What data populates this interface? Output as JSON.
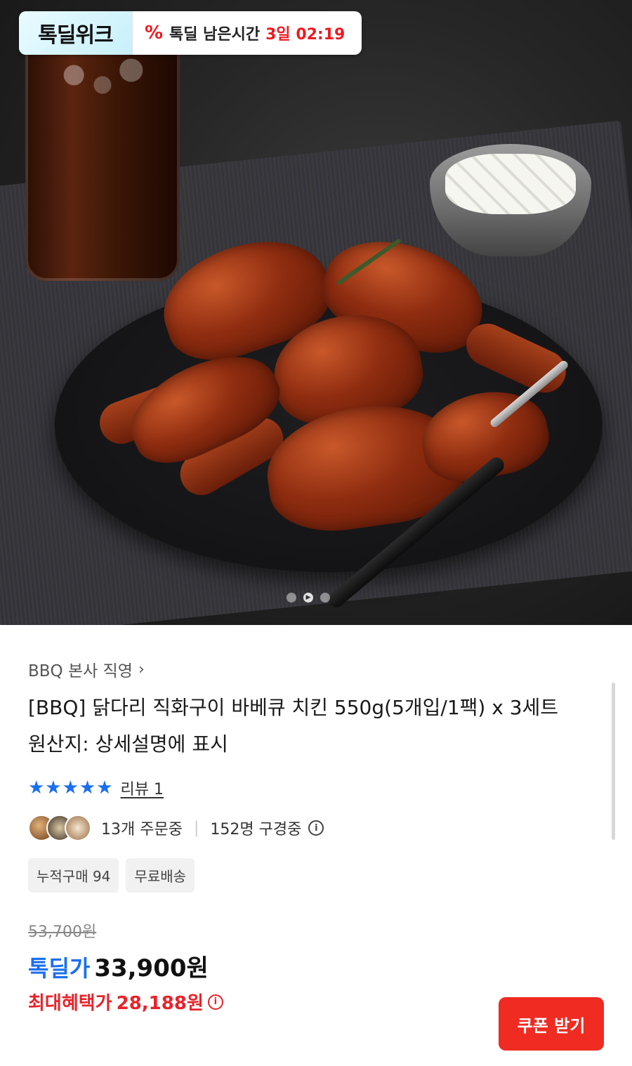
{
  "banner": {
    "logo_text": "톡딜위크",
    "icon": "percent-icon",
    "label": "톡딜 남은시간",
    "time_left": "3일 02:19"
  },
  "carousel": {
    "image_alt": "바베큐 닭다리 치킨 사진",
    "total_slides": 3,
    "current_slide": 2
  },
  "product": {
    "seller": "BBQ 본사 직영",
    "title": "[BBQ] 닭다리 직화구이 바베큐 치킨 550g(5개입/1팩) x 3세트",
    "origin": "원산지: 상세설명에 표시",
    "rating_stars": "★★★★★",
    "review_label": "리뷰 1",
    "orders": "13개 주문중",
    "viewers": "152명 구경중"
  },
  "tags": [
    "누적구매 94",
    "무료배송"
  ],
  "pricing": {
    "original_price": "53,700원",
    "deal_label": "톡딜가",
    "deal_price": "33,900원",
    "benefit_label": "최대혜택가",
    "benefit_price": "28,188원",
    "coupon_button": "쿠폰 받기"
  },
  "colors": {
    "accent_blue": "#1a6ff0",
    "accent_red": "#e8232a",
    "coupon_red": "#ef2b22"
  }
}
